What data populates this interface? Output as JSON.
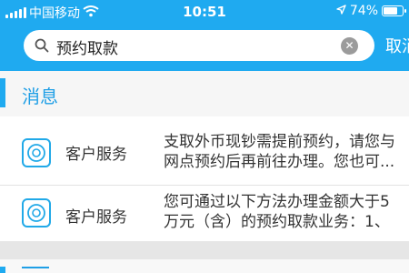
{
  "status_bar": {
    "carrier": "中国移动",
    "time": "10:51",
    "battery": "74%",
    "battery_level": 0.74,
    "icons": [
      "signal-bars-icon",
      "wifi-icon",
      "location-arrow-icon",
      "battery-icon"
    ]
  },
  "search": {
    "query": "预约取款",
    "cancel_label": "取消",
    "icons": [
      "search-icon",
      "clear-icon"
    ]
  },
  "section": {
    "title": "消息"
  },
  "results": [
    {
      "label": "客户服务",
      "line1": "支取外币现钞需提前预约，请您与",
      "line2": "网点预约后再前往办理。您也可..."
    },
    {
      "label": "客户服务",
      "line1": "您可通过以下方法办理金额大于5",
      "line2": "万元（含）的预约取款业务：1、"
    }
  ],
  "colors": {
    "accent": "#1faaf0",
    "section_title": "#1f9fe6",
    "background": "#ececec"
  }
}
